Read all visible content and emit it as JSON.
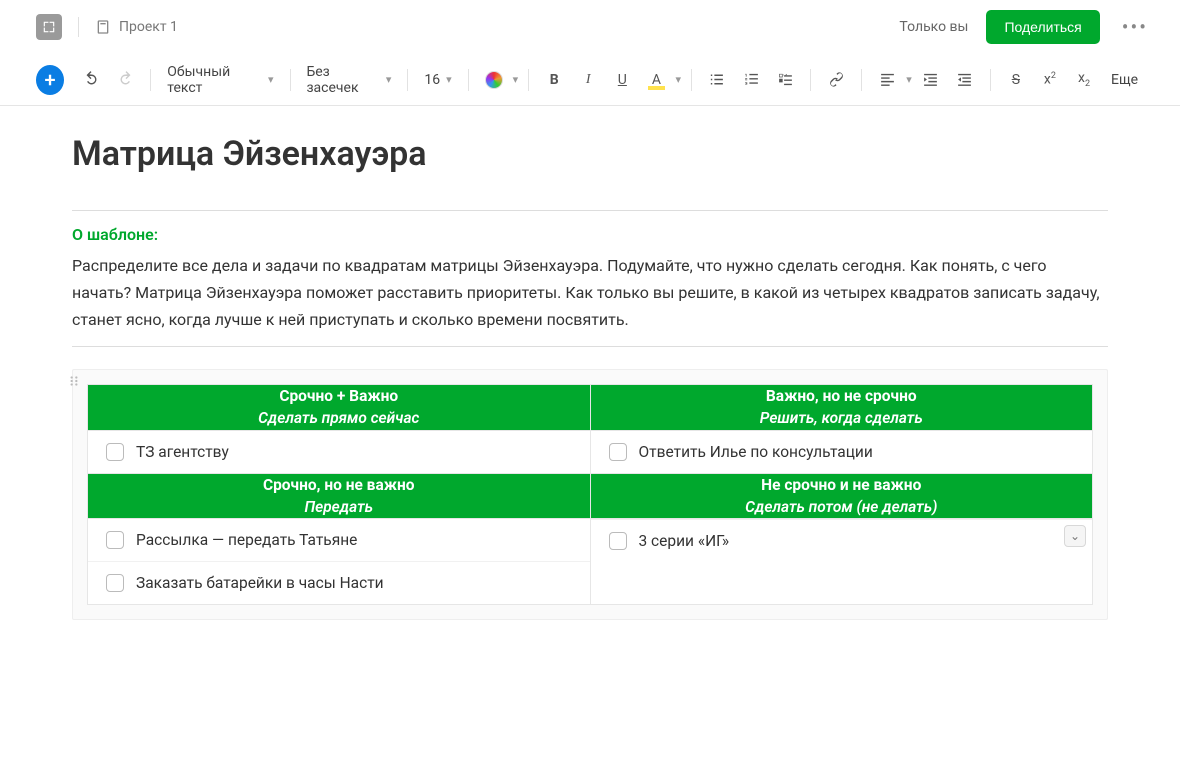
{
  "header": {
    "breadcrumb": "Проект 1",
    "only_you": "Только вы",
    "share": "Поделиться"
  },
  "toolbar": {
    "style_select": "Обычный текст",
    "font_select": "Без засечек",
    "font_size": "16",
    "more": "Еще"
  },
  "doc": {
    "title": "Матрица Эйзенхауэра",
    "template_heading": "О шаблоне:",
    "template_desc": "Распределите все дела и задачи по квадратам матрицы Эйзенхауэра. Подумайте, что нужно сделать сегодня. Как понять, с чего начать? Матрица Эйзенхауэра поможет расставить приоритеты. Как только вы решите, в какой из четырех квадратов записать задачу, станет ясно, когда лучше к ней приступать и сколько времени посвятить."
  },
  "matrix": {
    "q1": {
      "title": "Срочно + Важно",
      "sub": "Сделать прямо сейчас",
      "tasks": [
        "ТЗ агентству"
      ]
    },
    "q2": {
      "title": "Важно, но не срочно",
      "sub": "Решить, когда сделать",
      "tasks": [
        "Ответить Илье по консультации"
      ]
    },
    "q3": {
      "title": "Срочно, но не важно",
      "sub": "Передать",
      "tasks": [
        "Рассылка — передать Татьяне",
        "Заказать батарейки в часы Насти"
      ]
    },
    "q4": {
      "title": "Не срочно и не важно",
      "sub": "Сделать потом (не делать)",
      "tasks": [
        "3 серии «ИГ»"
      ]
    }
  }
}
